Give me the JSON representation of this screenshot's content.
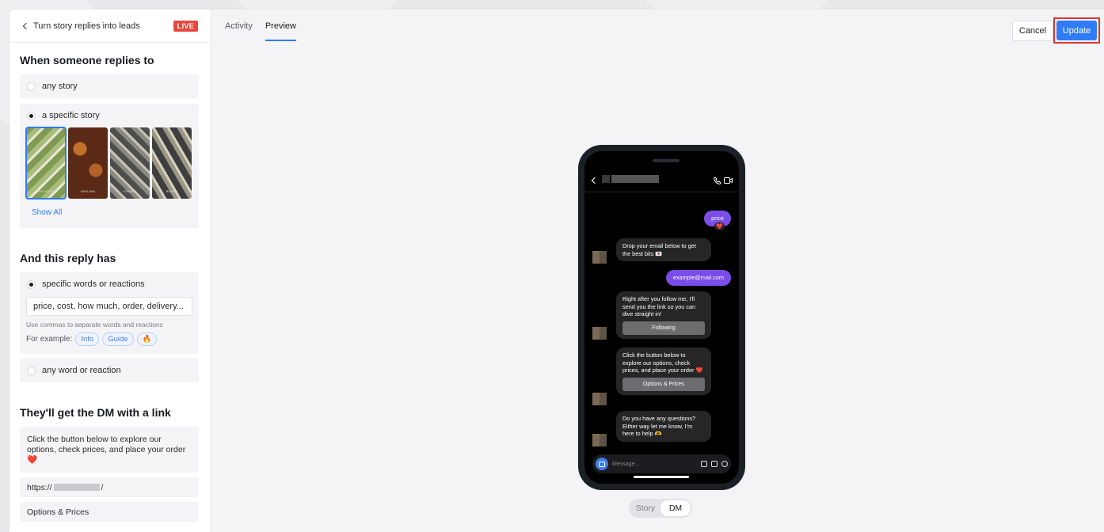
{
  "header": {
    "back_label": "Turn story replies into leads",
    "status_badge": "LIVE",
    "tabs": [
      {
        "label": "Activity"
      },
      {
        "label": "Preview"
      }
    ],
    "cancel_label": "Cancel",
    "update_label": "Update"
  },
  "trigger": {
    "title": "When someone replies to",
    "option_any": "any story",
    "option_specific": "a specific story",
    "thumb_captions": [
      "PISTACHIO",
      "BAKLAVA",
      "KUNAFA",
      "BURMA"
    ],
    "show_all": "Show All"
  },
  "condition": {
    "title": "And this reply has",
    "option_words": "specific words or reactions",
    "keywords_value": "price, cost, how much, order, delivery...",
    "hint": "Use commas to separate words and reactions",
    "example_label": "For example:",
    "chips": [
      "Info",
      "Guide",
      "🔥"
    ],
    "option_any": "any word or reaction"
  },
  "dm": {
    "title": "They'll get the DM with a link",
    "message": "Click the button below to explore our options, check prices, and place your order ❤️",
    "link_prefix": "https://",
    "link_suffix": "/",
    "button_label": "Options & Prices"
  },
  "phone": {
    "out_price": "price",
    "heart": "❤️",
    "msg_email": "Drop your email below to get the best bits 💌",
    "out_email": "example@mail.com",
    "msg_follow": "Right after you follow me, I'll send you the link so you can dive straight in!",
    "btn_follow": "Following",
    "msg_options": "Click the button below to explore our options, check prices, and place your order ❤️",
    "btn_options": "Options & Prices",
    "msg_questions": "Do you have any questions? Either way let me know, I'm here to help 🫶",
    "compose_placeholder": "Message..."
  },
  "view_toggle": {
    "story": "Story",
    "dm": "DM"
  },
  "colors": {
    "accent": "#2f7cf6",
    "live": "#e7473c",
    "outgoing_bubble": "#7a4de8",
    "highlight": "#e2332a"
  }
}
